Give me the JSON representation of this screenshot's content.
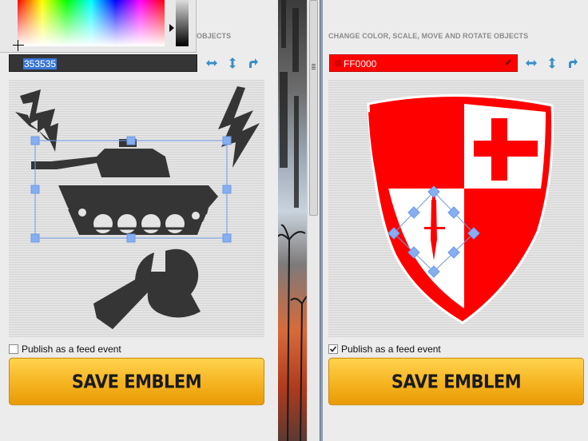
{
  "left_editor": {
    "section_title": "OBJECTS",
    "color_value": "353535",
    "publish_label": "Publish as a feed event",
    "publish_checked": false,
    "save_label": "SAVE EMBLEM"
  },
  "right_editor": {
    "section_title": "CHANGE COLOR, SCALE, MOVE AND ROTATE OBJECTS",
    "color_value": "FF0000",
    "publish_label": "Publish as a feed event",
    "publish_checked": true,
    "save_label": "SAVE EMBLEM"
  },
  "colors": {
    "accent": "#3a8fc7",
    "left_object": "#353535",
    "right_object": "#ff0000",
    "selection": "#6d9be6",
    "button": "#f5b320"
  },
  "icons": [
    "horizontal-flip-icon",
    "vertical-flip-icon",
    "rotate-icon",
    "pen-icon",
    "checkbox-icon"
  ]
}
